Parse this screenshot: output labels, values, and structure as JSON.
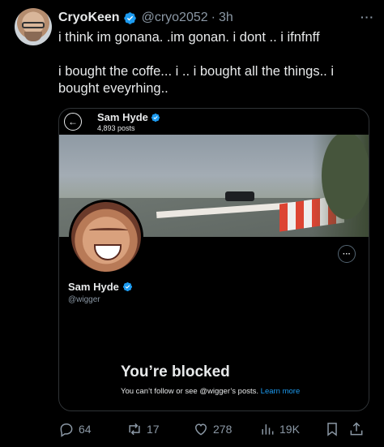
{
  "tweet": {
    "author_name": "CryoKeen",
    "author_handle": "@cryo2052",
    "separator": "·",
    "time": "3h",
    "more_icon": "···",
    "paragraphs": [
      "i think im gonana. .im gonan. i dont .. i ifnfnff",
      "i bought the coffe... i .. i bought all the things.. i bought eveyrhing.."
    ]
  },
  "embedded_profile": {
    "back_icon": "←",
    "name": "Sam Hyde",
    "posts": "4,893 posts",
    "profile_name": "Sam Hyde",
    "handle": "@wigger",
    "more_icon": "···",
    "blocked_title": "You’re blocked",
    "blocked_desc": "You can’t follow or see @wigger’s posts.",
    "learn_more": "Learn more"
  },
  "actions": {
    "replies": "64",
    "reposts": "17",
    "likes": "278",
    "views": "19K"
  },
  "colors": {
    "verified": "#1d9bf0",
    "text": "#e7e9ea",
    "muted": "#8b98a5",
    "link": "#1d9bf0"
  }
}
